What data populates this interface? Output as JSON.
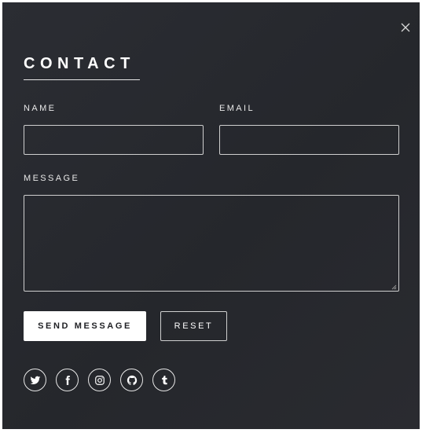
{
  "modal": {
    "title": "CONTACT",
    "close_icon": "close-icon"
  },
  "form": {
    "name_label": "NAME",
    "name_value": "",
    "email_label": "EMAIL",
    "email_value": "",
    "message_label": "MESSAGE",
    "message_value": ""
  },
  "actions": {
    "send_label": "SEND MESSAGE",
    "reset_label": "RESET"
  },
  "social": [
    {
      "icon": "twitter-icon"
    },
    {
      "icon": "facebook-icon"
    },
    {
      "icon": "instagram-icon"
    },
    {
      "icon": "github-icon"
    },
    {
      "icon": "tumblr-icon"
    }
  ],
  "colors": {
    "background": "#27292e",
    "text": "#ffffff",
    "border": "#cfcfcf",
    "primary_button_bg": "#ffffff",
    "primary_button_text": "#1f2024"
  }
}
